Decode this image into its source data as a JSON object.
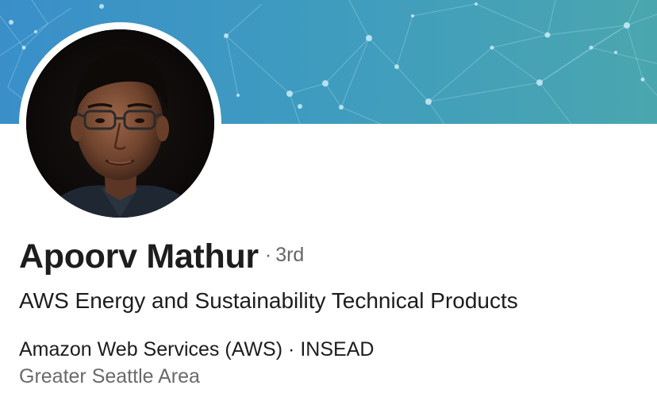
{
  "profile": {
    "name": "Apoorv Mathur",
    "separator": "·",
    "connection_degree": "3rd",
    "headline": "AWS Energy and Sustainability Technical Products",
    "current_company": "Amazon Web Services (AWS)",
    "work_separator": "·",
    "education": "INSEAD",
    "location": "Greater Seattle Area"
  },
  "colors": {
    "cover_left": "#3f95c6",
    "cover_right": "#4aa3b0",
    "name_text": "#1d1d1d",
    "secondary_text": "#666666"
  },
  "icons": {
    "cover": "network-constellation-pattern",
    "avatar": "profile-photo"
  }
}
